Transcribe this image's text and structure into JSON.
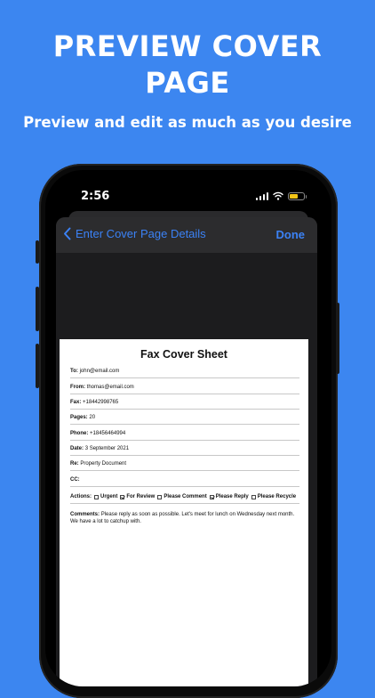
{
  "promo": {
    "title_line1": "PREVIEW COVER",
    "title_line2": "PAGE",
    "subtitle": "Preview and edit as much as you desire"
  },
  "status_bar": {
    "time": "2:56",
    "battery_color": "#f5c518"
  },
  "nav": {
    "back_label": "Enter Cover Page Details",
    "done_label": "Done",
    "accent_color": "#3b82f6"
  },
  "document": {
    "title": "Fax Cover Sheet",
    "fields": [
      {
        "label": "To:",
        "value": "john@email.com"
      },
      {
        "label": "From:",
        "value": "thomas@email.com"
      },
      {
        "label": "Fax:",
        "value": "+18442998765"
      },
      {
        "label": "Pages:",
        "value": "20"
      },
      {
        "label": "Phone:",
        "value": "+18456464994"
      },
      {
        "label": "Date:",
        "value": "3 September 2021"
      },
      {
        "label": "Re:",
        "value": "Property Document"
      },
      {
        "label": "CC:",
        "value": ""
      }
    ],
    "actions_label": "Actions:",
    "actions": [
      {
        "label": "Urgent",
        "checked": false
      },
      {
        "label": "For Review",
        "checked": true
      },
      {
        "label": "Please Comment",
        "checked": false
      },
      {
        "label": "Please Reply",
        "checked": true
      },
      {
        "label": "Please Recycle",
        "checked": false
      }
    ],
    "comments_label": "Comments:",
    "comments_text": "Please reply as soon as possible. Let's meet for lunch on Wednesday next month. We have a lot to catchup with."
  }
}
